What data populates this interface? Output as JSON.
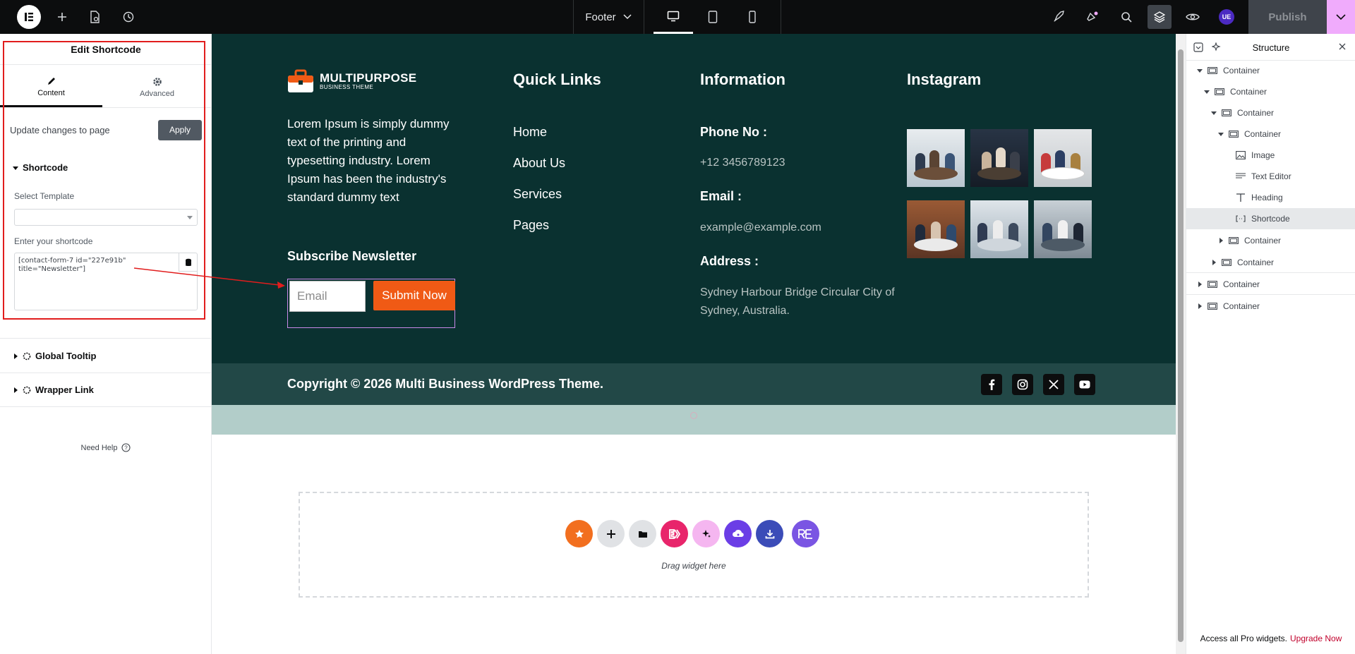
{
  "topbar": {
    "document_title": "Footer",
    "publish_label": "Publish",
    "user_initials": "UE"
  },
  "left_panel": {
    "title": "Edit Shortcode",
    "tabs": [
      {
        "label": "Content",
        "icon": "pencil-icon",
        "active": true
      },
      {
        "label": "Advanced",
        "icon": "gear-icon",
        "active": false
      }
    ],
    "update_text": "Update changes to page",
    "apply_label": "Apply",
    "section_shortcode": "Shortcode",
    "select_template_label": "Select Template",
    "select_template_value": "",
    "shortcode_label": "Enter your shortcode",
    "shortcode_value": "[contact-form-7 id=\"227e91b\" title=\"Newsletter\"]",
    "section_tooltip": "Global Tooltip",
    "section_wrapper": "Wrapper Link",
    "need_help": "Need Help"
  },
  "footer": {
    "brand_name": "MULTIPURPOSE",
    "brand_sub": "BUSINESS THEME",
    "about_text": "Lorem Ipsum is simply dummy text of the printing and typesetting industry. Lorem Ipsum has been the industry's standard dummy text",
    "subscribe_heading": "Subscribe Newsletter",
    "email_placeholder": "Email",
    "submit_label": "Submit Now",
    "quick_links_heading": "Quick Links",
    "quick_links": [
      "Home",
      "About Us",
      "Services",
      "Pages"
    ],
    "information_heading": "Information",
    "phone_label": "Phone No :",
    "phone_value": "+12 3456789123",
    "email_label": "Email :",
    "email_value": "example@example.com",
    "address_label": "Address :",
    "address_value": "Sydney Harbour Bridge Circular City of Sydney, Australia.",
    "instagram_heading": "Instagram",
    "copyright": "Copyright © 2026 Multi Business WordPress Theme.",
    "social_icons": [
      "facebook-icon",
      "instagram-icon",
      "x-icon",
      "youtube-icon"
    ]
  },
  "drop_zone": {
    "label": "Drag widget here"
  },
  "structure": {
    "title": "Structure",
    "items": [
      {
        "label": "Container",
        "type": "container"
      },
      {
        "label": "Container",
        "type": "container"
      },
      {
        "label": "Container",
        "type": "container"
      },
      {
        "label": "Container",
        "type": "container"
      },
      {
        "label": "Image",
        "type": "image"
      },
      {
        "label": "Text Editor",
        "type": "text-editor"
      },
      {
        "label": "Heading",
        "type": "heading"
      },
      {
        "label": "Shortcode",
        "type": "shortcode",
        "selected": true
      },
      {
        "label": "Container",
        "type": "container"
      },
      {
        "label": "Container",
        "type": "container"
      },
      {
        "label": "Container",
        "type": "container"
      },
      {
        "label": "Container",
        "type": "container"
      }
    ],
    "upgrade_text": "Access all Pro widgets.",
    "upgrade_link": "Upgrade Now"
  },
  "colors": {
    "footer_bg": "#0a3130",
    "copyright_bg": "#224847",
    "accent_orange": "#f05a15",
    "annotation_red": "#e11d1d"
  }
}
